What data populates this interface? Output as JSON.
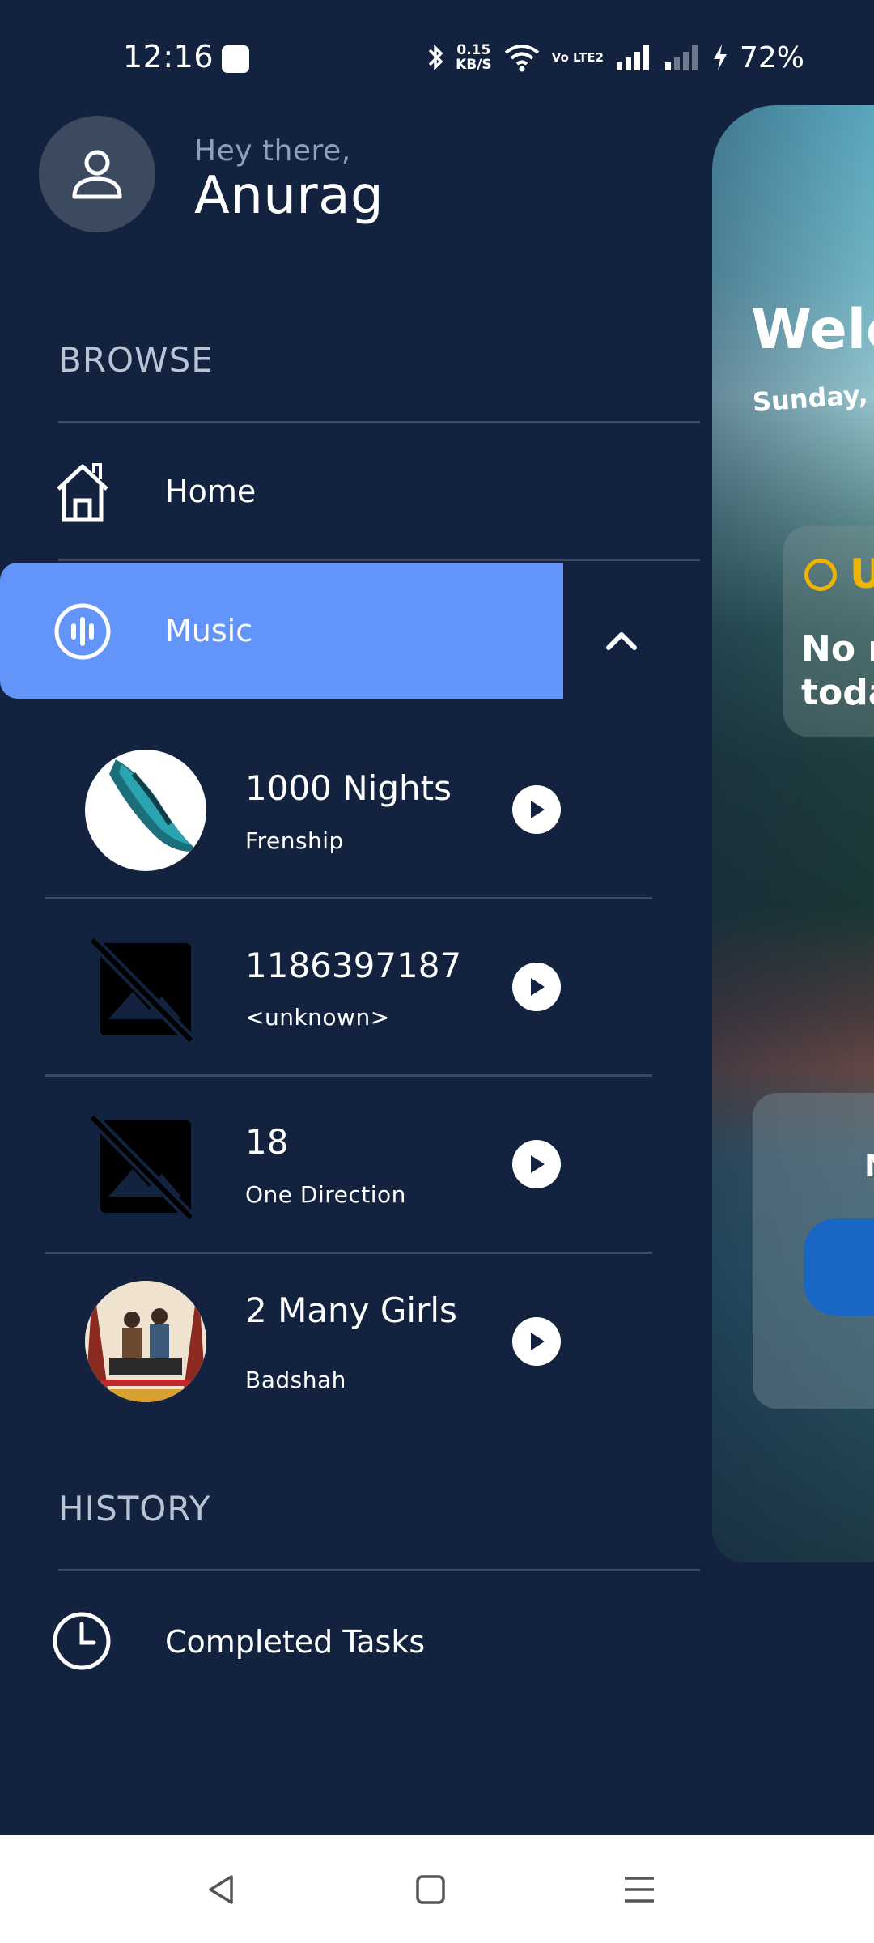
{
  "status_bar": {
    "time": "12:16",
    "net_speed_value": "0.15",
    "net_speed_unit": "KB/S",
    "volte": "Vo LTE2",
    "battery": "72%"
  },
  "drawer": {
    "greeting": "Hey there,",
    "user_name": "Anurag",
    "browse_title": "BROWSE",
    "home_label": "Home",
    "music_label": "Music",
    "songs": [
      {
        "title": "1000 Nights",
        "artist": "Frenship"
      },
      {
        "title": "1186397187",
        "artist": "<unknown>"
      },
      {
        "title": "18",
        "artist": "One Direction"
      },
      {
        "title": "2 Many Girls",
        "artist": "Badshah"
      }
    ],
    "history_title": "HISTORY",
    "completed_label": "Completed Tasks"
  },
  "background_app": {
    "welcome": "Welc",
    "date": "Sunday, A",
    "upcoming_initial": "U",
    "no_tasks": "No n",
    "no_tasks_2": "toda",
    "card_initial": "N"
  },
  "colors": {
    "background": "#13233f",
    "highlight": "#6394fa",
    "divider": "#3b4a63"
  }
}
